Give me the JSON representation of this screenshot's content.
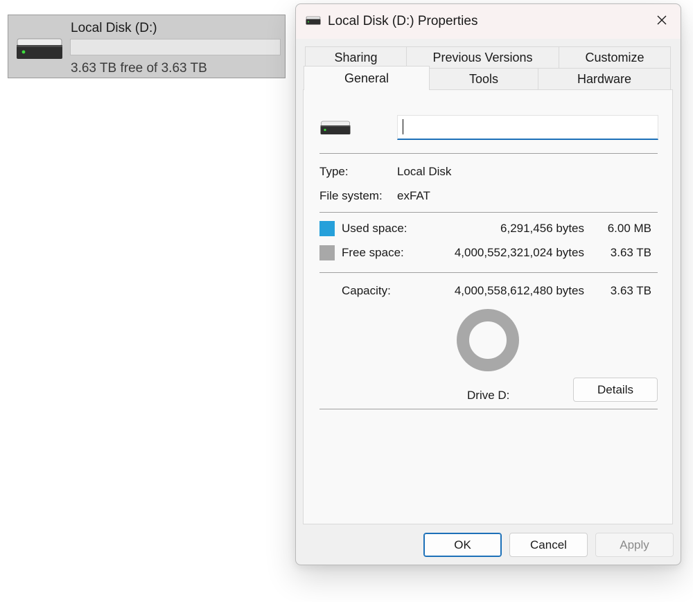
{
  "drive_tile": {
    "name": "Local Disk (D:)",
    "free_text": "3.63 TB free of 3.63 TB",
    "used_fraction": 0.0
  },
  "dialog": {
    "title": "Local Disk (D:) Properties",
    "tabs_back": [
      "Sharing",
      "Previous Versions",
      "Customize"
    ],
    "tabs_front": [
      "General",
      "Tools",
      "Hardware"
    ],
    "active_tab": "General",
    "label_input": {
      "value": "",
      "placeholder": ""
    },
    "type_label": "Type:",
    "type_value": "Local Disk",
    "fs_label": "File system:",
    "fs_value": "exFAT",
    "used": {
      "label": "Used space:",
      "bytes": "6,291,456 bytes",
      "size": "6.00 MB",
      "color": "#26a0da"
    },
    "free": {
      "label": "Free space:",
      "bytes": "4,000,552,321,024 bytes",
      "size": "3.63 TB",
      "color": "#a8a8a8"
    },
    "capacity": {
      "label": "Capacity:",
      "bytes": "4,000,558,612,480 bytes",
      "size": "3.63 TB"
    },
    "donut_used_fraction": 1.6e-06,
    "drive_caption": "Drive D:",
    "details_label": "Details",
    "buttons": {
      "ok": "OK",
      "cancel": "Cancel",
      "apply": "Apply"
    },
    "icons": {
      "drive": "hard-drive-icon",
      "close": "close-icon"
    }
  }
}
